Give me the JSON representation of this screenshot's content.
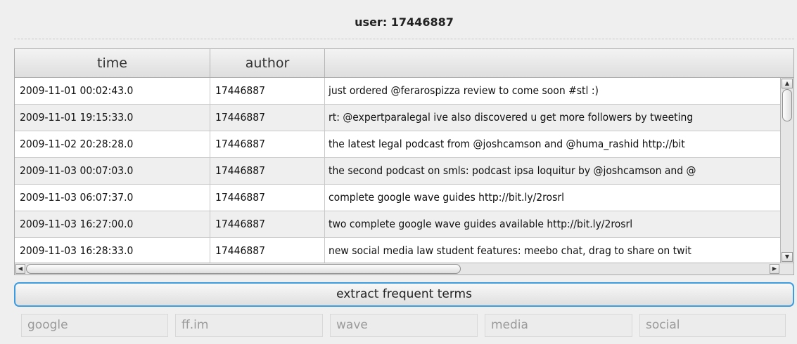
{
  "header": {
    "title": "user: 17446887"
  },
  "table": {
    "columns": [
      "time",
      "author",
      ""
    ],
    "rows": [
      {
        "time": "2009-11-01 00:02:43.0",
        "author": "17446887",
        "text": "just ordered @ferarospizza review to come soon #stl :)"
      },
      {
        "time": "2009-11-01 19:15:33.0",
        "author": "17446887",
        "text": "rt: @expertparalegal ive also discovered u get more followers by tweeting"
      },
      {
        "time": "2009-11-02 20:28:28.0",
        "author": "17446887",
        "text": "the latest legal podcast from @joshcamson and @huma_rashid  http://bit"
      },
      {
        "time": "2009-11-03 00:07:03.0",
        "author": "17446887",
        "text": "the second podcast on smls: podcast ipsa loquitur by @joshcamson and @"
      },
      {
        "time": "2009-11-03 06:07:37.0",
        "author": "17446887",
        "text": "complete google wave guides  http://bit.ly/2rosrl"
      },
      {
        "time": "2009-11-03 16:27:00.0",
        "author": "17446887",
        "text": "two complete google wave guides available  http://bit.ly/2rosrl"
      },
      {
        "time": "2009-11-03 16:28:33.0",
        "author": "17446887",
        "text": "new social media law student features: meebo chat, drag to share on twit"
      }
    ]
  },
  "actions": {
    "extract_label": "extract frequent terms"
  },
  "terms": [
    "google",
    "ff.im",
    "wave",
    "media",
    "social"
  ]
}
